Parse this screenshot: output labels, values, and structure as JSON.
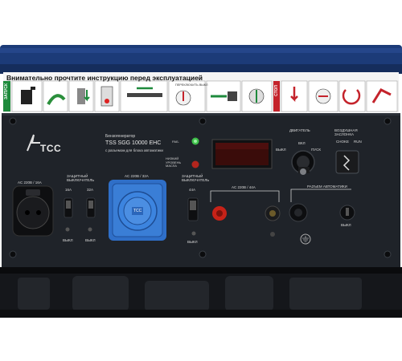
{
  "warning_banner": {
    "title": "Внимательно прочтите инструкцию перед эксплуатацией",
    "start_label": "ЗАПУСК",
    "stop_label": "СТОП",
    "step_caption": "ПЕРЕКЛЮЧИТЬ ВЫКЛ"
  },
  "brand": {
    "logo": "TCC",
    "product_type": "Бензогенератор",
    "model": "TSS SGG 10000 EHC",
    "subtitle": "с разъемом для блока автоматики"
  },
  "panel": {
    "outlet_16a_label": "AC 220В / 16А",
    "breaker_title": "ЗАЩИТНЫЙ ВЫКЛЮЧАТЕЛЬ",
    "breaker_16a": "16А",
    "breaker_32a": "32А",
    "breaker_off_left": "ВЫКЛ",
    "breaker_off_right": "ВЫКЛ",
    "outlet_32a_label": "AC 220В / 32А",
    "blue_socket_text": "TCC",
    "breaker_44a_title": "ЗАЩИТНЫЙ ВЫКЛЮЧАТЕЛЬ",
    "breaker_44a_value": "44А",
    "breaker_44a_off": "ВЫКЛ",
    "led_work": "РАБ.",
    "led_low_oil": "НИЗКИЙ УРОВЕНЬ МАСЛА",
    "terminal_label": "AC 220В / 44А",
    "engine_label": "ДВИГАТЕЛЬ",
    "key_on": "ВКЛ",
    "key_start": "ПУСК",
    "key_off": "ВЫКЛ",
    "choke_title": "ВОЗДУШНАЯ ЗАСЛОНКА",
    "choke_on": "CHOKE",
    "choke_run": "RUN",
    "automation_label": "РАЗЪЕМ АВТОМАТИКИ",
    "automation_off": "ВЫКЛ"
  },
  "colors": {
    "frame_blue": "#1c3b78",
    "panel_bg": "#1f2329",
    "banner_bg": "#ececec",
    "banner_green": "#1e8a3c",
    "banner_red": "#c4232b",
    "socket_blue": "#2f6fc8",
    "terminal_red": "#c72218",
    "led_green": "#3fbf4a",
    "led_red": "#b3251d",
    "display_red": "#5a1210"
  },
  "icons": [
    "fuel-can-icon",
    "oil-check-icon",
    "valve-icon",
    "breaker-off-icon",
    "lever-icon",
    "switch-down-icon",
    "choke-icon",
    "key-start-icon",
    "power-off-icon",
    "stop-key-icon",
    "fuel-off-icon",
    "warning-hand-icon"
  ]
}
